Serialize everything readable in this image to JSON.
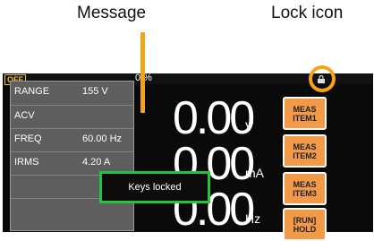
{
  "callouts": {
    "message": "Message",
    "lock_icon": "Lock icon"
  },
  "status": {
    "output_state": "OFF",
    "percent": "0 %"
  },
  "parameters": [
    {
      "name": "RANGE",
      "value": "155 V"
    },
    {
      "name": "ACV",
      "value": ""
    },
    {
      "name": "FREQ",
      "value": "60.00 Hz"
    },
    {
      "name": "IRMS",
      "value": "4.20 A"
    }
  ],
  "readings": [
    {
      "value": "0.00",
      "unit": "V"
    },
    {
      "value": "0.00",
      "unit": "mA"
    },
    {
      "value": "0.00",
      "unit": "Hz"
    }
  ],
  "message": "Keys locked",
  "soft_keys": [
    {
      "line1": "MEAS",
      "line2": "ITEM1"
    },
    {
      "line1": "MEAS",
      "line2": "ITEM2"
    },
    {
      "line1": "MEAS",
      "line2": "ITEM3"
    },
    {
      "line1": "[RUN]",
      "line2": "HOLD"
    }
  ],
  "colors": {
    "accent": "#f5a21a",
    "badge": "#f0c02a",
    "message_border": "#25c43a",
    "soft_key": "#f29a48"
  },
  "icons": {
    "lock": "lock-icon"
  }
}
